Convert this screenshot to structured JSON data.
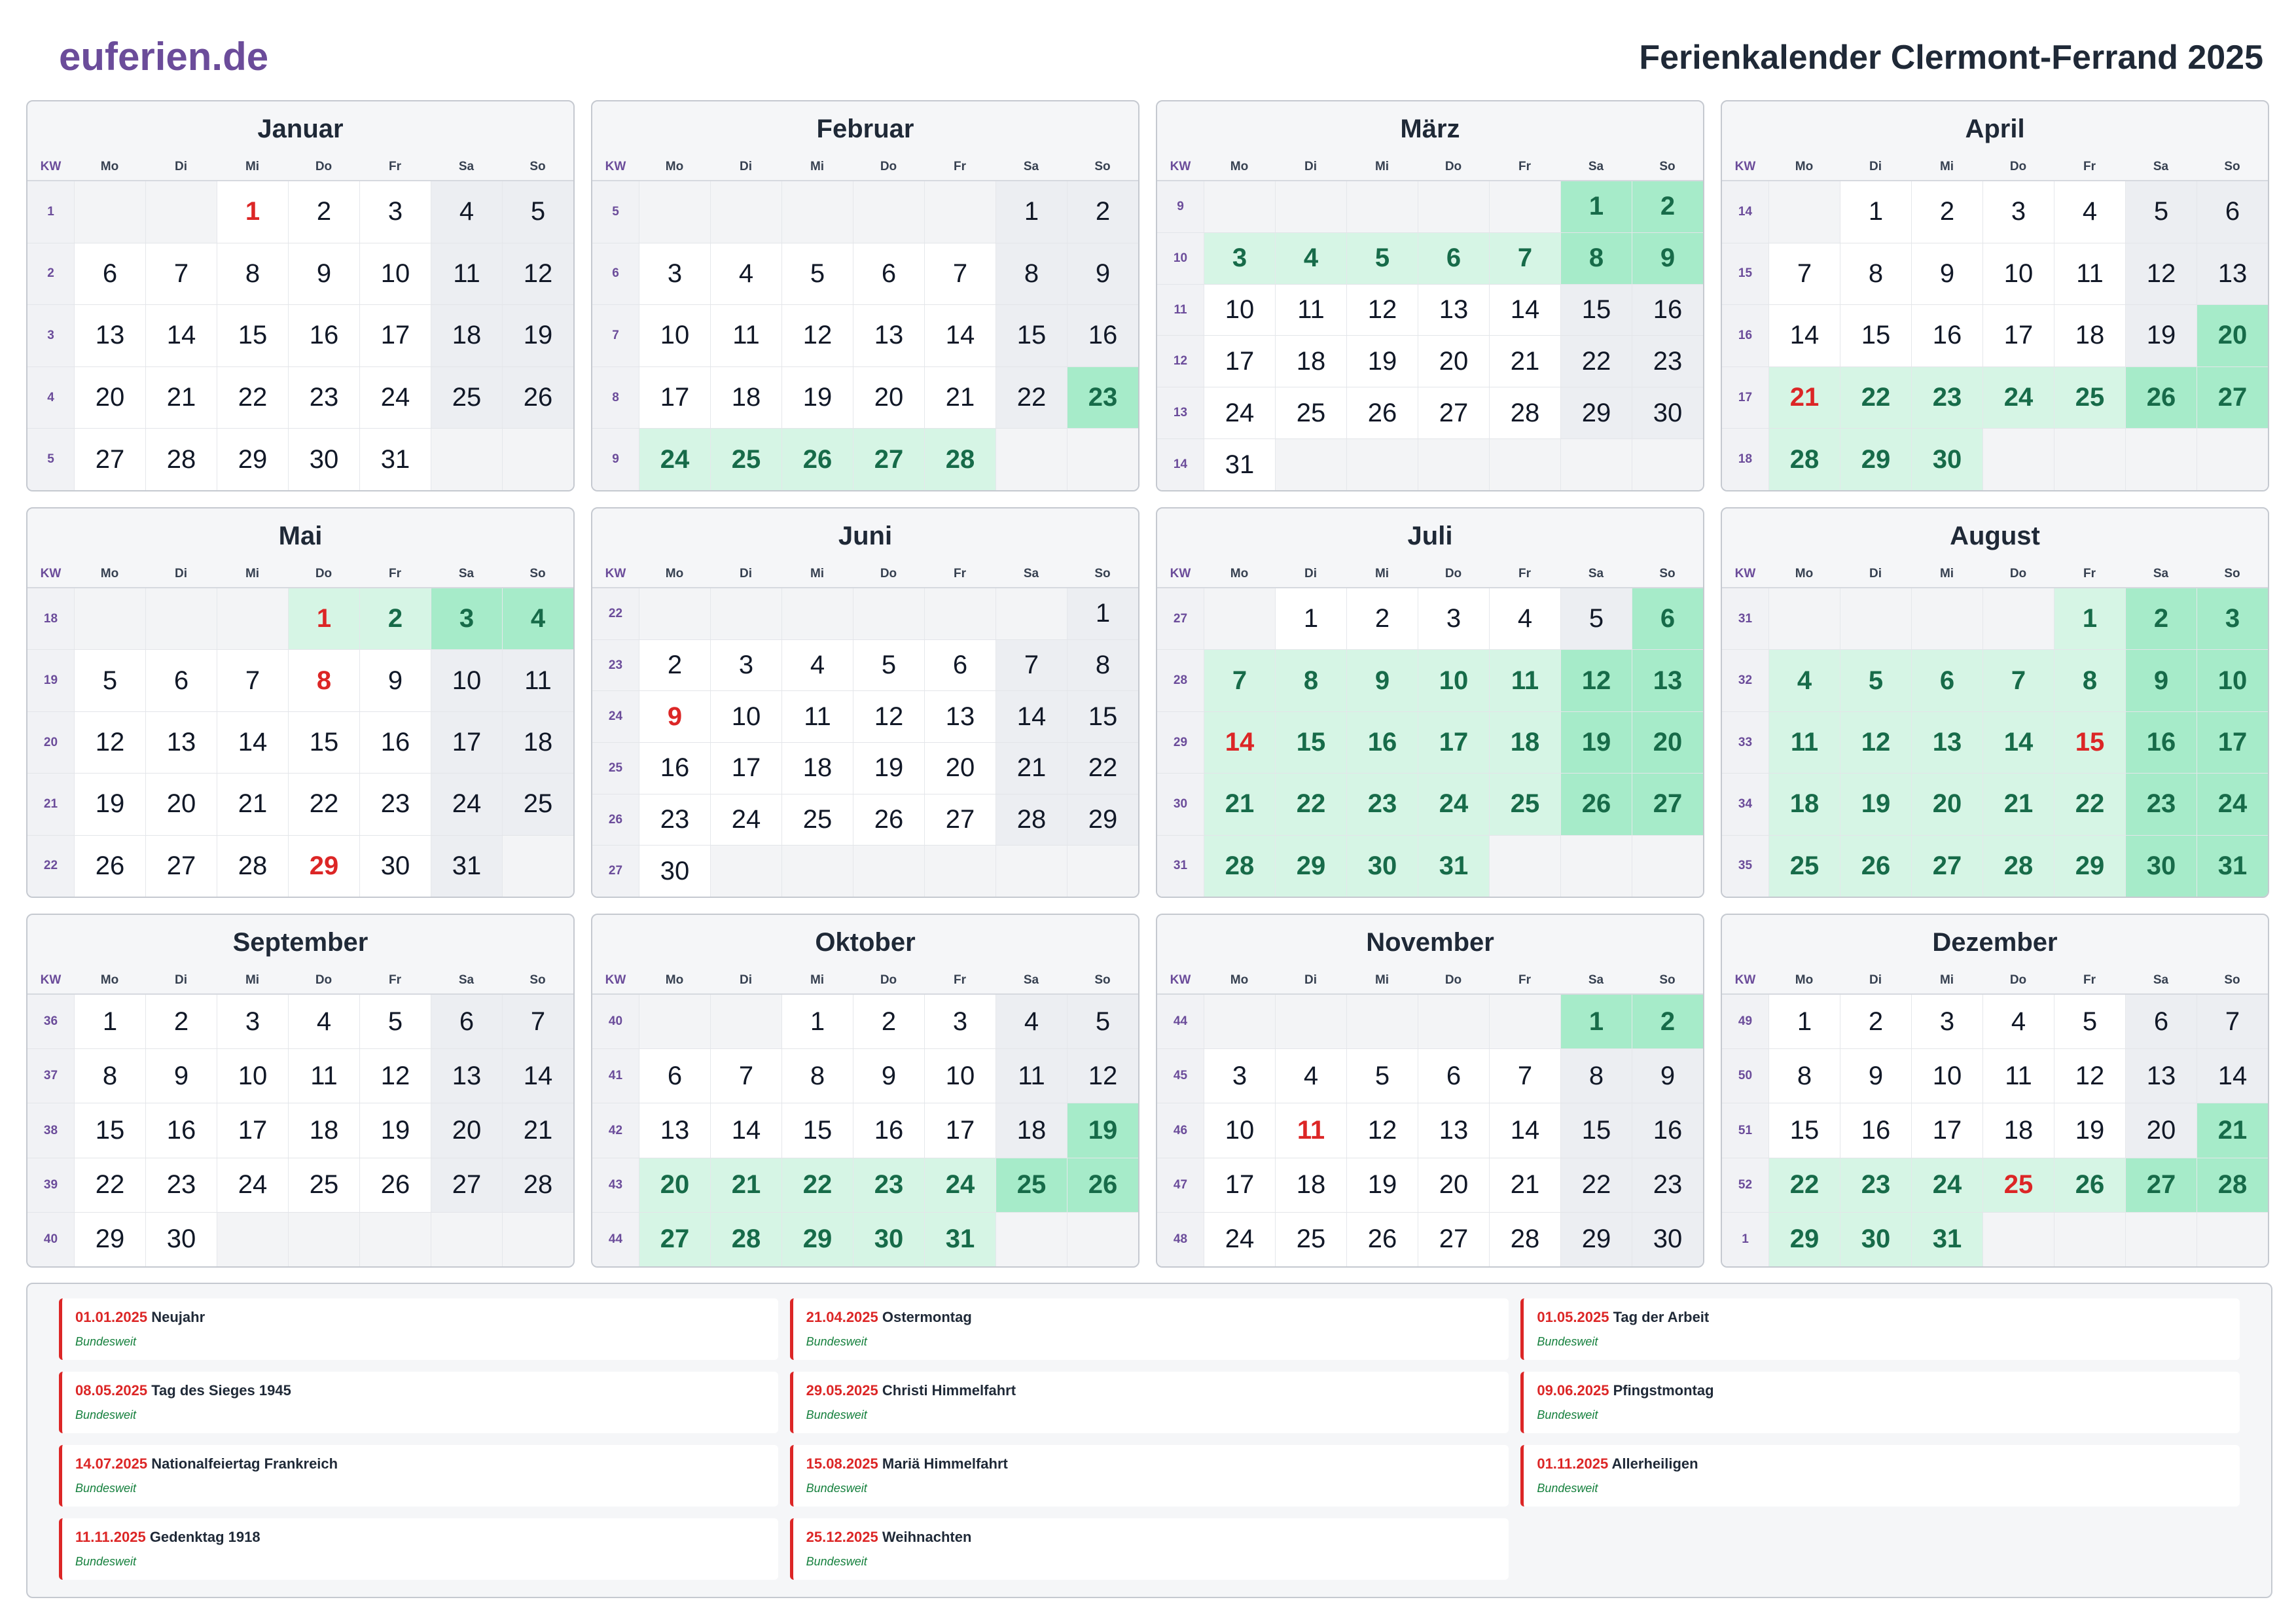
{
  "header": {
    "logo": "euferien.de",
    "title": "Ferienkalender Clermont-Ferrand 2025"
  },
  "weekday_headers": {
    "kw": "KW",
    "days": [
      "Mo",
      "Di",
      "Mi",
      "Do",
      "Fr",
      "Sa",
      "So"
    ]
  },
  "months": [
    {
      "name": "Januar",
      "kw": [
        "1",
        "2",
        "3",
        "4",
        "5"
      ],
      "first_weekday": 2,
      "days_in_month": 31,
      "vacation_days": [],
      "holiday_days": [
        1
      ]
    },
    {
      "name": "Februar",
      "kw": [
        "5",
        "6",
        "7",
        "8",
        "9"
      ],
      "first_weekday": 5,
      "days_in_month": 28,
      "vacation_days": [
        23,
        24,
        25,
        26,
        27,
        28
      ],
      "holiday_days": []
    },
    {
      "name": "März",
      "kw": [
        "9",
        "10",
        "11",
        "12",
        "13",
        "14"
      ],
      "first_weekday": 5,
      "days_in_month": 31,
      "vacation_days": [
        1,
        2,
        3,
        4,
        5,
        6,
        7,
        8,
        9
      ],
      "holiday_days": []
    },
    {
      "name": "April",
      "kw": [
        "14",
        "15",
        "16",
        "17",
        "18"
      ],
      "first_weekday": 1,
      "days_in_month": 30,
      "vacation_days": [
        20,
        21,
        22,
        23,
        24,
        25,
        26,
        27,
        28,
        29,
        30
      ],
      "holiday_days": [
        21
      ]
    },
    {
      "name": "Mai",
      "kw": [
        "18",
        "19",
        "20",
        "21",
        "22"
      ],
      "first_weekday": 3,
      "days_in_month": 31,
      "vacation_days": [
        1,
        2,
        3,
        4
      ],
      "holiday_days": [
        1,
        8,
        29
      ]
    },
    {
      "name": "Juni",
      "kw": [
        "22",
        "23",
        "24",
        "25",
        "26",
        "27"
      ],
      "first_weekday": 6,
      "days_in_month": 30,
      "vacation_days": [],
      "holiday_days": [
        9
      ]
    },
    {
      "name": "Juli",
      "kw": [
        "27",
        "28",
        "29",
        "30",
        "31"
      ],
      "first_weekday": 1,
      "days_in_month": 31,
      "vacation_days": [
        6,
        7,
        8,
        9,
        10,
        11,
        12,
        13,
        14,
        15,
        16,
        17,
        18,
        19,
        20,
        21,
        22,
        23,
        24,
        25,
        26,
        27,
        28,
        29,
        30,
        31
      ],
      "holiday_days": [
        14
      ]
    },
    {
      "name": "August",
      "kw": [
        "31",
        "32",
        "33",
        "34",
        "35"
      ],
      "first_weekday": 4,
      "days_in_month": 31,
      "vacation_days": [
        1,
        2,
        3,
        4,
        5,
        6,
        7,
        8,
        9,
        10,
        11,
        12,
        13,
        14,
        15,
        16,
        17,
        18,
        19,
        20,
        21,
        22,
        23,
        24,
        25,
        26,
        27,
        28,
        29,
        30,
        31
      ],
      "holiday_days": [
        15
      ]
    },
    {
      "name": "September",
      "kw": [
        "36",
        "37",
        "38",
        "39",
        "40"
      ],
      "first_weekday": 0,
      "days_in_month": 30,
      "vacation_days": [],
      "holiday_days": []
    },
    {
      "name": "Oktober",
      "kw": [
        "40",
        "41",
        "42",
        "43",
        "44"
      ],
      "first_weekday": 2,
      "days_in_month": 31,
      "vacation_days": [
        19,
        20,
        21,
        22,
        23,
        24,
        25,
        26,
        27,
        28,
        29,
        30,
        31
      ],
      "holiday_days": []
    },
    {
      "name": "November",
      "kw": [
        "44",
        "45",
        "46",
        "47",
        "48"
      ],
      "first_weekday": 5,
      "days_in_month": 30,
      "vacation_days": [
        1,
        2
      ],
      "holiday_days": [
        1,
        11
      ]
    },
    {
      "name": "Dezember",
      "kw": [
        "49",
        "50",
        "51",
        "52",
        "1"
      ],
      "first_weekday": 0,
      "days_in_month": 31,
      "vacation_days": [
        21,
        22,
        23,
        24,
        25,
        26,
        27,
        28,
        29,
        30,
        31
      ],
      "holiday_days": [
        25
      ]
    }
  ],
  "holidays": [
    {
      "date": "01.01.2025",
      "name": "Neujahr",
      "scope": "Bundesweit"
    },
    {
      "date": "21.04.2025",
      "name": "Ostermontag",
      "scope": "Bundesweit"
    },
    {
      "date": "01.05.2025",
      "name": "Tag der Arbeit",
      "scope": "Bundesweit"
    },
    {
      "date": "08.05.2025",
      "name": "Tag des Sieges 1945",
      "scope": "Bundesweit"
    },
    {
      "date": "29.05.2025",
      "name": "Christi Himmelfahrt",
      "scope": "Bundesweit"
    },
    {
      "date": "09.06.2025",
      "name": "Pfingstmontag",
      "scope": "Bundesweit"
    },
    {
      "date": "14.07.2025",
      "name": "Nationalfeiertag Frankreich",
      "scope": "Bundesweit"
    },
    {
      "date": "15.08.2025",
      "name": "Mariä Himmelfahrt",
      "scope": "Bundesweit"
    },
    {
      "date": "01.11.2025",
      "name": "Allerheiligen",
      "scope": "Bundesweit"
    },
    {
      "date": "11.11.2025",
      "name": "Gedenktag 1918",
      "scope": "Bundesweit"
    },
    {
      "date": "25.12.2025",
      "name": "Weihnachten",
      "scope": "Bundesweit"
    }
  ],
  "colors": {
    "brand": "#6b4c9a",
    "holiday": "#dc2626",
    "vacation": "#d6f5e5",
    "vacation_weekend": "#a6ebc9",
    "vacation_text": "#176b49"
  }
}
